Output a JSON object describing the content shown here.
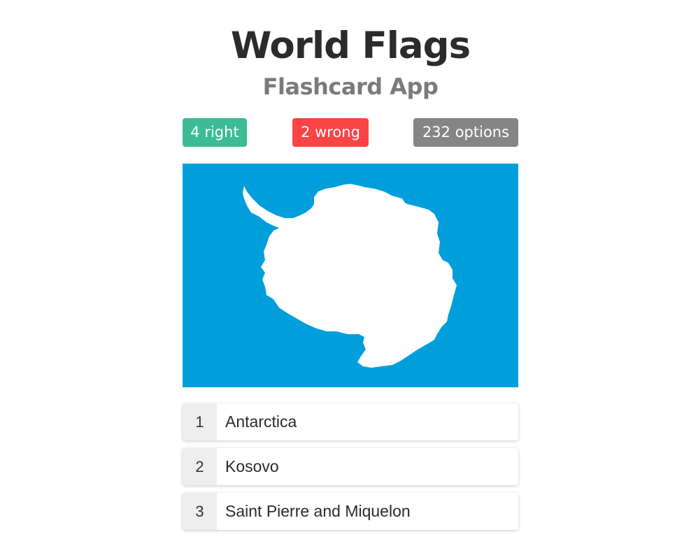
{
  "header": {
    "title": "World Flags",
    "subtitle": "Flashcard App"
  },
  "score": {
    "right_label": "4 right",
    "wrong_label": "2 wrong",
    "options_label": "232 options",
    "right_color": "#3dbb94",
    "wrong_color": "#fb4446",
    "options_color": "#858585"
  },
  "flag": {
    "icon": "antarctica-flag",
    "background_color": "#009fdb",
    "shape_color": "#ffffff"
  },
  "choices": [
    {
      "number": "1",
      "label": "Antarctica"
    },
    {
      "number": "2",
      "label": "Kosovo"
    },
    {
      "number": "3",
      "label": "Saint Pierre and Miquelon"
    }
  ]
}
